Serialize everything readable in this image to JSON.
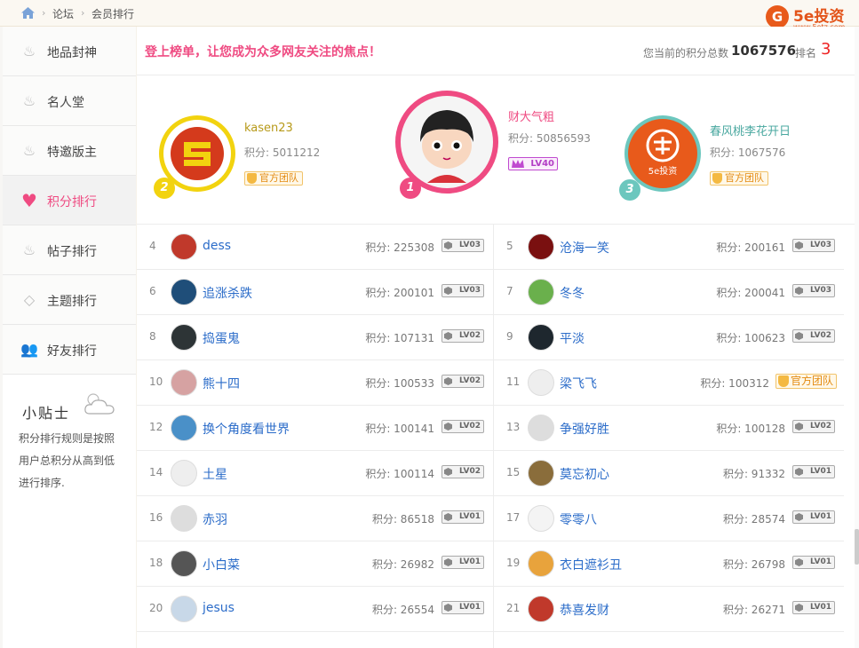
{
  "breadcrumb": {
    "items": [
      "论坛",
      "会员排行"
    ]
  },
  "logo": {
    "text": "5e投资",
    "url": "www.5etz.com"
  },
  "sidebar": {
    "items": [
      {
        "label": "地品封神",
        "icon": "flame-icon"
      },
      {
        "label": "名人堂",
        "icon": "flame-icon"
      },
      {
        "label": "特邀版主",
        "icon": "flame-icon"
      },
      {
        "label": "积分排行",
        "icon": "heart-icon",
        "active": true
      },
      {
        "label": "帖子排行",
        "icon": "flame-icon"
      },
      {
        "label": "主题排行",
        "icon": "diamond-icon"
      },
      {
        "label": "好友排行",
        "icon": "users-icon"
      }
    ],
    "tips": {
      "title": "小贴士",
      "text": "积分排行规则是按照用户总积分从高到低进行排序."
    }
  },
  "header": {
    "headline": "登上榜单，让您成为众多网友关注的焦点！",
    "score_label": "您当前的积分总数",
    "score_value": "1067576",
    "rank_label": "排名",
    "rank_value": "3"
  },
  "podium": [
    {
      "rank": "1",
      "name": "财大气粗",
      "score": "积分: 50856593",
      "level": "LV40"
    },
    {
      "rank": "2",
      "name": "kasen23",
      "score": "积分: 5011212",
      "tag": "官方团队"
    },
    {
      "rank": "3",
      "name": "春风桃李花开日",
      "score": "积分: 1067576",
      "tag": "官方团队"
    }
  ],
  "ranking": {
    "left": [
      {
        "rank": "4",
        "name": "dess",
        "score": "积分: 225308",
        "level": "LV03"
      },
      {
        "rank": "6",
        "name": "追涨杀跌",
        "score": "积分: 200101",
        "level": "LV03"
      },
      {
        "rank": "8",
        "name": "捣蛋鬼",
        "score": "积分: 107131",
        "level": "LV02"
      },
      {
        "rank": "10",
        "name": "熊十四",
        "score": "积分: 100533",
        "level": "LV02"
      },
      {
        "rank": "12",
        "name": "换个角度看世界",
        "score": "积分: 100141",
        "level": "LV02"
      },
      {
        "rank": "14",
        "name": "土星",
        "score": "积分: 100114",
        "level": "LV02"
      },
      {
        "rank": "16",
        "name": "赤羽",
        "score": "积分: 86518",
        "level": "LV01"
      },
      {
        "rank": "18",
        "name": "小白菜",
        "score": "积分: 26982",
        "level": "LV01"
      },
      {
        "rank": "20",
        "name": "jesus",
        "score": "积分: 26554",
        "level": "LV01"
      }
    ],
    "right": [
      {
        "rank": "5",
        "name": "沧海一笑",
        "score": "积分: 200161",
        "level": "LV03"
      },
      {
        "rank": "7",
        "name": "冬冬",
        "score": "积分: 200041",
        "level": "LV03"
      },
      {
        "rank": "9",
        "name": "平淡",
        "score": "积分: 100623",
        "level": "LV02"
      },
      {
        "rank": "11",
        "name": "梁飞飞",
        "score": "积分: 100312",
        "tag": "官方团队"
      },
      {
        "rank": "13",
        "name": "争强好胜",
        "score": "积分: 100128",
        "level": "LV02"
      },
      {
        "rank": "15",
        "name": "莫忘初心",
        "score": "积分: 91332",
        "level": "LV01"
      },
      {
        "rank": "17",
        "name": "零零八",
        "score": "积分: 28574",
        "level": "LV01"
      },
      {
        "rank": "19",
        "name": "衣白遮衫丑",
        "score": "积分: 26798",
        "level": "LV01"
      },
      {
        "rank": "21",
        "name": "恭喜发财",
        "score": "积分: 26271",
        "level": "LV01"
      }
    ]
  },
  "colors": {
    "accent": "#ef4b82",
    "link": "#2b6cc9",
    "brand": "#e85a1b",
    "gold": "#f4b942"
  }
}
